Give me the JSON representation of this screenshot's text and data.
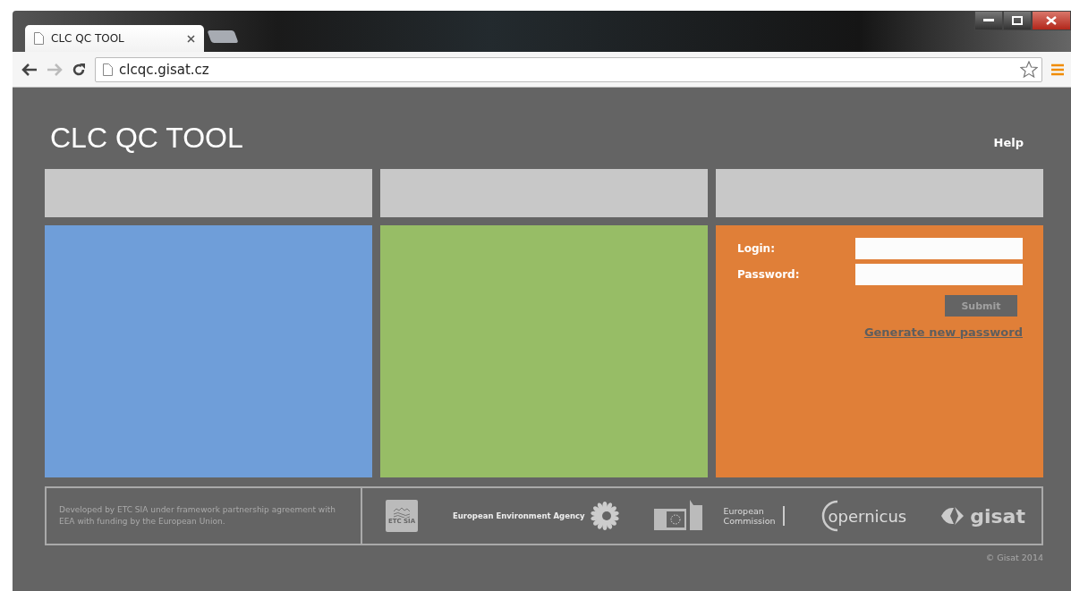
{
  "browser": {
    "tab_title": "CLC QC TOOL",
    "url": "clcqc.gisat.cz"
  },
  "header": {
    "title": "CLC QC TOOL",
    "help": "Help"
  },
  "tiles": [
    {
      "color": "#6f9ed9"
    },
    {
      "color": "#97bd66"
    },
    {
      "color": "#e07f38"
    }
  ],
  "login": {
    "fields": [
      {
        "label": "Login:"
      },
      {
        "label": "Password:"
      }
    ],
    "submit": {
      "label": "Submit",
      "disabled": true
    },
    "link": "Generate new password"
  },
  "footer": {
    "text": "Developed by ETC SIA under framework partnership agreement with EEA with funding by the European Union.",
    "logos": [
      {
        "kind": "etc",
        "text": "ETC SIA"
      },
      {
        "kind": "eea",
        "text": "European Environment Agency"
      },
      {
        "kind": "ec",
        "text": "European Commission"
      },
      {
        "kind": "copernicus",
        "text": "opernicus"
      },
      {
        "kind": "gisat",
        "text": "gisat"
      }
    ],
    "copyright": "© Gisat 2014"
  }
}
